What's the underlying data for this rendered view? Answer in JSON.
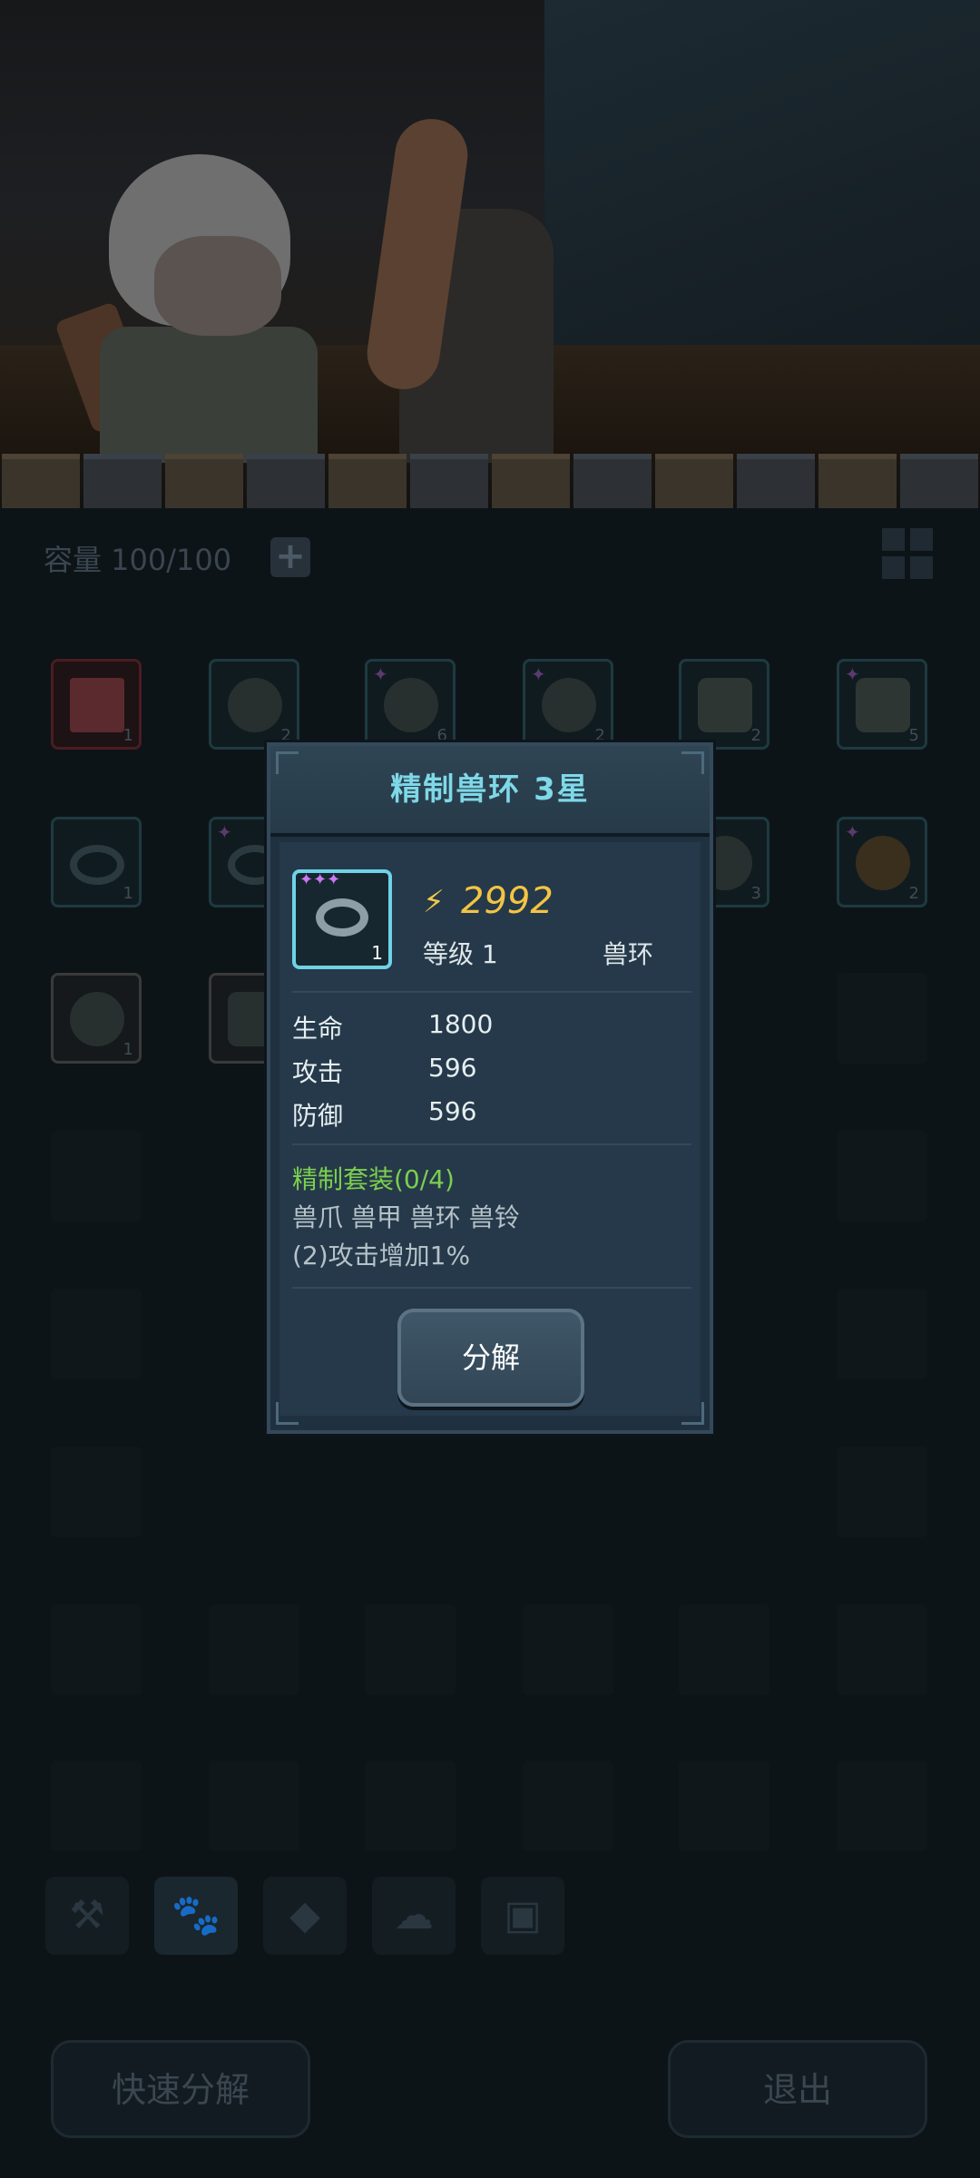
{
  "inventory": {
    "capacity_label": "容量 100/100",
    "add_icon": "plus-icon",
    "grid_icon": "grid-view-icon",
    "slots": [
      {
        "count": "1"
      },
      {
        "count": "2"
      },
      {
        "count": "6"
      },
      {
        "count": "2"
      },
      {
        "count": "2"
      },
      {
        "count": "5"
      },
      {
        "count": "1"
      },
      {
        "count": ""
      },
      {
        "count": "3"
      },
      {
        "count": "2"
      },
      {
        "count": "1"
      },
      {
        "count": ""
      }
    ]
  },
  "tabs": [
    "wrench-icon",
    "paw-icon",
    "gem-icon",
    "cloud-icon",
    "chest-icon"
  ],
  "bottom": {
    "quick_decompose": "快速分解",
    "exit": "退出"
  },
  "dialog": {
    "title": "精制兽环 3星",
    "item": {
      "count": "1",
      "stars": "✦✦✦"
    },
    "power": "2992",
    "level": "等级 1",
    "type": "兽环",
    "stats": [
      {
        "label": "生命",
        "value": "1800"
      },
      {
        "label": "攻击",
        "value": "596"
      },
      {
        "label": "防御",
        "value": "596"
      }
    ],
    "set_title": "精制套装(0/4)",
    "set_parts": "兽爪 兽甲 兽环 兽铃",
    "set_bonus": "(2)攻击增加1%",
    "button": "分解"
  },
  "colors": {
    "title": "#7fd8e8",
    "power": "#f3c443",
    "set_title": "#7bcf4e"
  }
}
